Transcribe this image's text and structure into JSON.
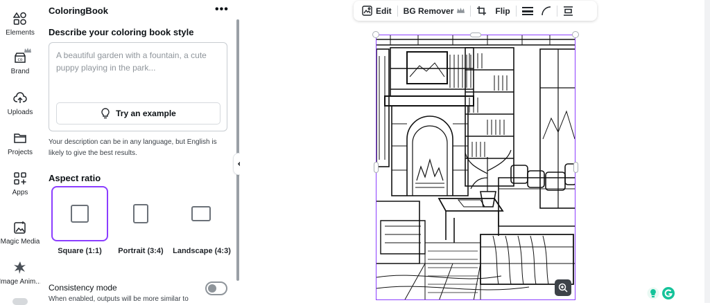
{
  "rail": {
    "items": [
      {
        "label": "Elements",
        "icon": "elements-icon"
      },
      {
        "label": "Brand",
        "icon": "brand-icon",
        "badge": "crown-icon"
      },
      {
        "label": "Uploads",
        "icon": "cloud-upload-icon"
      },
      {
        "label": "Projects",
        "icon": "folder-icon"
      },
      {
        "label": "Apps",
        "icon": "apps-grid-icon"
      },
      {
        "label": "Magic Media",
        "icon": "magic-media-icon"
      },
      {
        "label": "Image Anim...",
        "icon": "image-animate-icon"
      }
    ]
  },
  "panel": {
    "title": "ColoringBook",
    "menu": "•••",
    "describe_label": "Describe your coloring book style",
    "description_placeholder": "A beautiful garden with a fountain, a cute puppy playing in the park...",
    "try_example": "Try an example",
    "hint": "Your description can be in any language, but English is likely to give the best results.",
    "aspect_label": "Aspect ratio",
    "ratios": [
      {
        "label": "Square (1:1)",
        "selected": true
      },
      {
        "label": "Portrait (3:4)",
        "selected": false
      },
      {
        "label": "Landscape (4:3)",
        "selected": false
      }
    ],
    "consistency_label": "Consistency mode",
    "consistency_enabled": false,
    "consistency_desc": "When enabled, outputs will be more similar to"
  },
  "toolbar": {
    "edit": "Edit",
    "bg_remover": "BG Remover",
    "flip": "Flip"
  },
  "colors": {
    "accent": "#8b3dff",
    "text": "#0d1216",
    "muted": "#8f959b",
    "border": "#c7ccd1",
    "grammarly_green": "#15c39a"
  }
}
